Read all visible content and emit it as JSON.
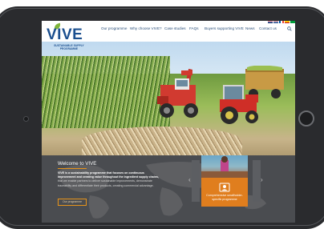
{
  "site": {
    "logo_text": "VIVE",
    "logo_subtitle": "SUSTAINABLE SUPPLY PROGRAMME"
  },
  "nav": {
    "items": [
      {
        "label": "Our programme"
      },
      {
        "label": "Why choose VIVE?"
      },
      {
        "label": "Case studies"
      },
      {
        "label": "FAQs"
      },
      {
        "label": "Buyers supporting VIVE"
      },
      {
        "label": "News"
      },
      {
        "label": "Contact us"
      }
    ]
  },
  "flags": [
    "uk-flag-icon",
    "nl-flag-icon",
    "fr-flag-icon",
    "es-flag-icon",
    "br-flag-icon"
  ],
  "welcome": {
    "title": "Welcome to VIVE",
    "lead": "VIVE is a sustainability programme that focuses on continuous improvement and creating value throughout the ingredient supply chains,",
    "body": " that we enable partners to deliver sustainable improvements, demonstrate traceability and differentiate their products, creating commercial advantage.",
    "button_label": "Our programme"
  },
  "card": {
    "label": "Comprehensive smallholder-specific programme"
  },
  "colors": {
    "brand_blue": "#1b4f8f",
    "accent_orange": "#e07e1e",
    "leaf_green": "#7fb53a",
    "panel_grey": "#4a4c50"
  }
}
